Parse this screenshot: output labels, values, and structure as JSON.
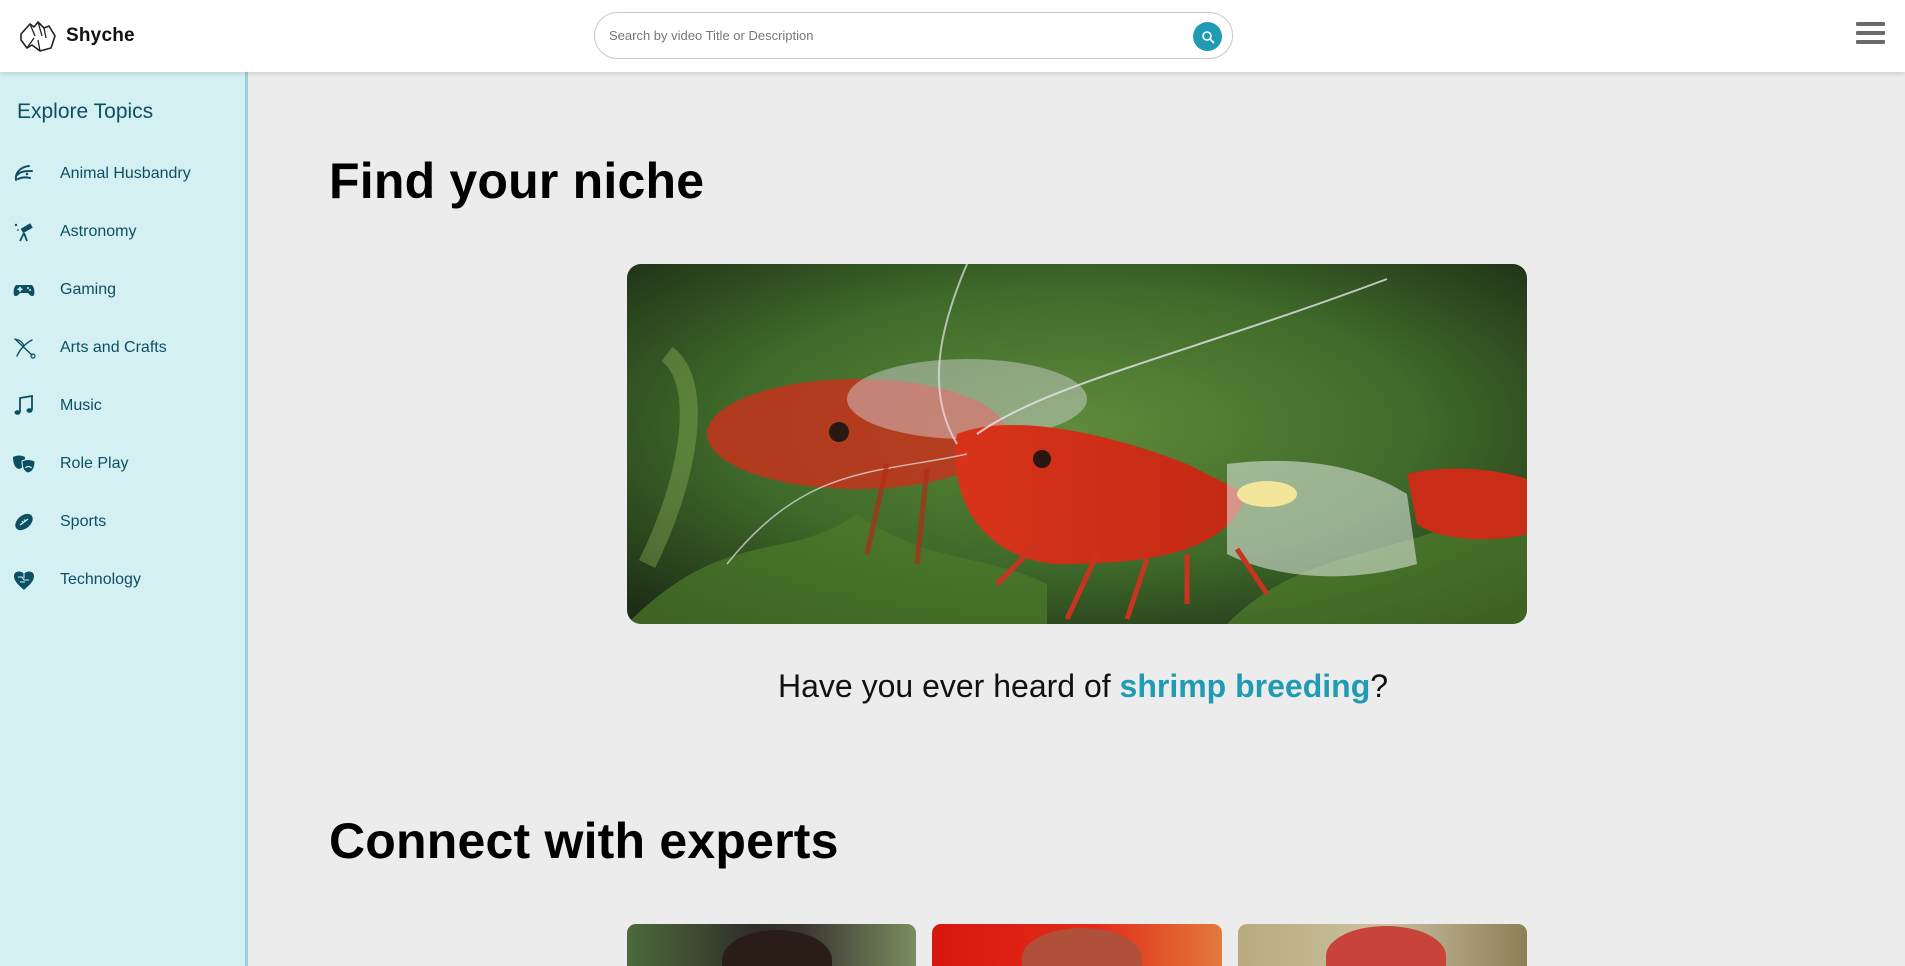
{
  "app": {
    "name": "Shyche"
  },
  "search": {
    "placeholder": "Search by video Title or Description",
    "value": ""
  },
  "sidebar": {
    "title": "Explore Topics",
    "items": [
      {
        "label": "Animal Husbandry",
        "icon": "shrimp-icon"
      },
      {
        "label": "Astronomy",
        "icon": "telescope-icon"
      },
      {
        "label": "Gaming",
        "icon": "gamepad-icon"
      },
      {
        "label": "Arts and Crafts",
        "icon": "scissors-icon"
      },
      {
        "label": "Music",
        "icon": "music-note-icon"
      },
      {
        "label": "Role Play",
        "icon": "theater-masks-icon"
      },
      {
        "label": "Sports",
        "icon": "football-icon"
      },
      {
        "label": "Technology",
        "icon": "brain-circuit-icon"
      }
    ]
  },
  "main": {
    "niche_heading": "Find your niche",
    "caption_prefix": "Have you ever heard of ",
    "caption_link": "shrimp breeding",
    "caption_suffix": "?",
    "experts_heading": "Connect with experts"
  },
  "colors": {
    "accent": "#1f9bb3",
    "sidebar_bg": "#d5f0f3",
    "sidebar_text": "#0c4f63",
    "page_bg": "#ececec"
  }
}
